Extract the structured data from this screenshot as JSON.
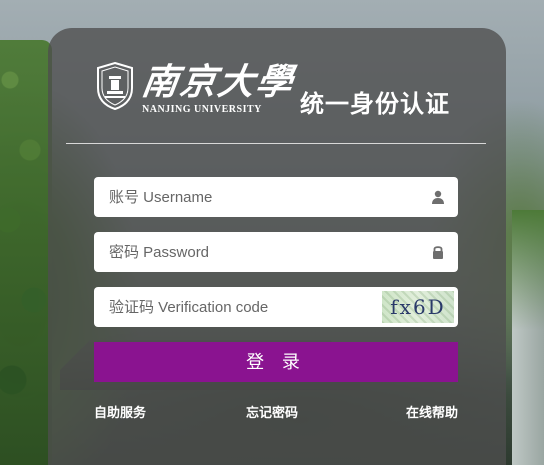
{
  "header": {
    "university_cn": "南京大學",
    "university_en": "NANJING UNIVERSITY",
    "system_title": "统一身份认证"
  },
  "form": {
    "username_placeholder": "账号 Username",
    "password_placeholder": "密码 Password",
    "captcha_placeholder": "验证码 Verification code",
    "captcha_text": "fx6D",
    "login_label": "登 录"
  },
  "links": {
    "self_service": "自助服务",
    "forgot_password": "忘记密码",
    "online_help": "在线帮助"
  },
  "colors": {
    "brand_purple": "#8a1390",
    "panel": "rgba(78,78,78,0.78)"
  },
  "icons": {
    "username": "user-icon",
    "password": "lock-icon",
    "emblem": "university-emblem-icon"
  }
}
